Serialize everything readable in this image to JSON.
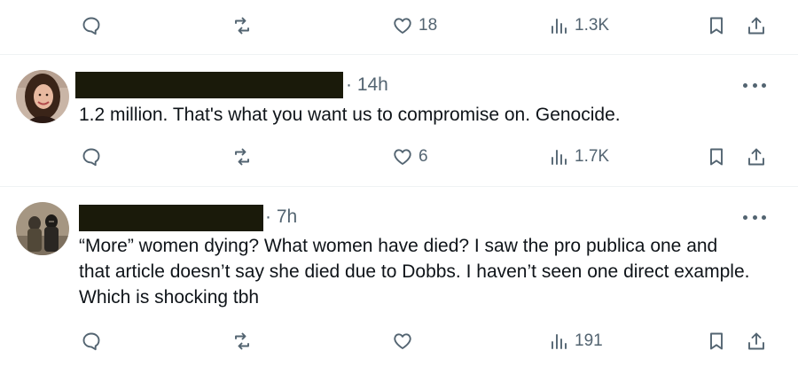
{
  "top_actions": {
    "reply_count": "",
    "retweet_count": "",
    "like_count": "18",
    "view_count": "1.3K"
  },
  "tweets": [
    {
      "author_name": "",
      "time": "· 14h",
      "text": "1.2 million. That's what you want us to compromise on. Genocide.",
      "reply_count": "",
      "retweet_count": "",
      "like_count": "6",
      "view_count": "1.7K"
    },
    {
      "author_name": "",
      "time": "· 7h",
      "text": "“More” women dying? What women have died? I saw the pro publica one and that article doesn’t say she died due to Dobbs. I haven’t seen one direct example. Which is shocking tbh",
      "reply_count": "",
      "retweet_count": "",
      "like_count": "",
      "view_count": "191"
    }
  ],
  "colors": {
    "icon": "#536471",
    "text": "#0f1419",
    "divider": "#eff3f4",
    "redaction": "#1a1a0a"
  },
  "icons": [
    "reply-icon",
    "retweet-icon",
    "like-icon",
    "views-icon",
    "bookmark-icon",
    "share-icon",
    "more-icon"
  ]
}
